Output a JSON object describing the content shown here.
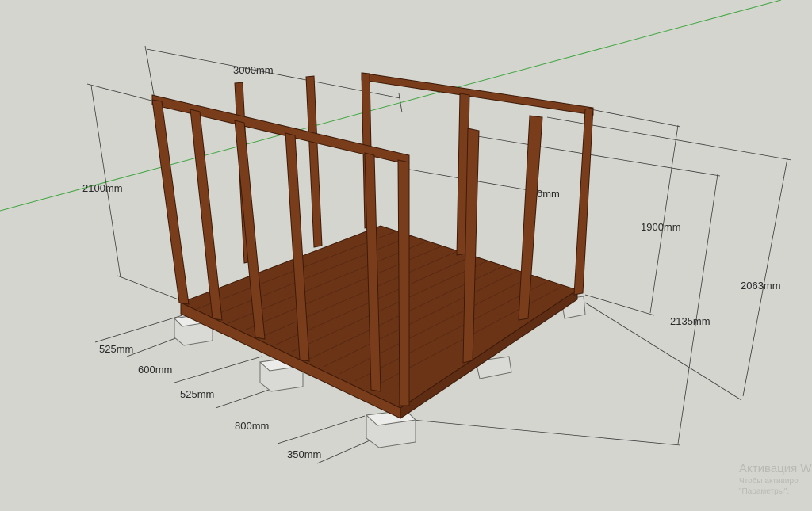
{
  "dimensions": {
    "top_width": "3000mm",
    "left_height": "2100mm",
    "partial_label": "0mm",
    "right_inner_height": "1900mm",
    "right_height": "2063mm",
    "front_depth": "2135mm",
    "gap_1": "525mm",
    "gap_2": "600mm",
    "gap_3": "525mm",
    "gap_4": "800mm",
    "gap_5": "350mm"
  },
  "watermark": {
    "title": "Активация W",
    "line1": "Чтобы активиро",
    "line2": "\"Параметры\"."
  },
  "colors": {
    "background": "#d4d5cf",
    "wood": "#7a3d1c",
    "wood_dark": "#4e2410",
    "deck": "#6b3417",
    "concrete": "#d9dad5",
    "axis_green": "#3fa63f"
  }
}
